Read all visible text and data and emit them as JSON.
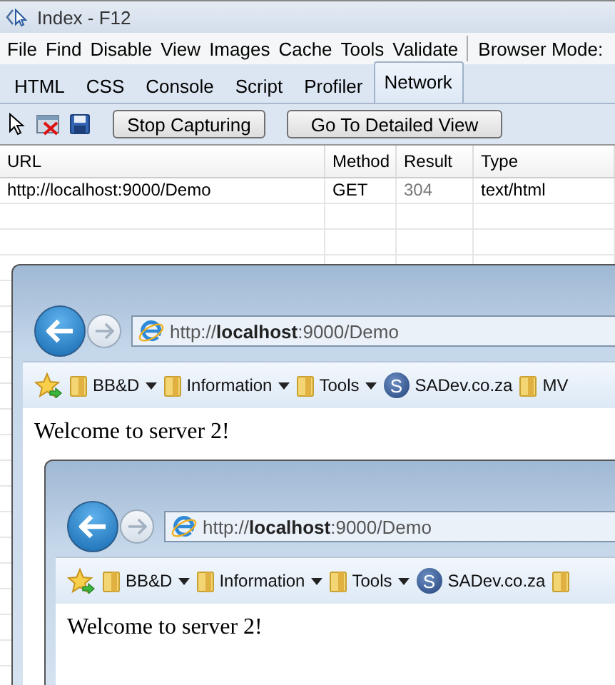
{
  "window": {
    "title": "Index - F12"
  },
  "menu": {
    "items": [
      "File",
      "Find",
      "Disable",
      "View",
      "Images",
      "Cache",
      "Tools",
      "Validate"
    ],
    "browser_mode": "Browser Mode:"
  },
  "tabs": [
    {
      "label": "HTML",
      "selected": false
    },
    {
      "label": "CSS",
      "selected": false
    },
    {
      "label": "Console",
      "selected": false
    },
    {
      "label": "Script",
      "selected": false
    },
    {
      "label": "Profiler",
      "selected": false
    },
    {
      "label": "Network",
      "selected": true
    }
  ],
  "toolbar": {
    "buttons": [
      "Stop Capturing",
      "Go To Detailed View"
    ]
  },
  "table": {
    "columns": [
      "URL",
      "Method",
      "Result",
      "Type"
    ],
    "rows": [
      {
        "url": "http://localhost:9000/Demo",
        "method": "GET",
        "result": "304",
        "type": "text/html"
      }
    ]
  },
  "browser_window": {
    "address": "http://**localhost**:9000/Demo",
    "favorites": [
      {
        "kind": "folder",
        "label": "BB&D",
        "dropdown": true
      },
      {
        "kind": "folder",
        "label": "Information",
        "dropdown": true
      },
      {
        "kind": "folder",
        "label": "Tools",
        "dropdown": true
      },
      {
        "kind": "site",
        "badge": "S",
        "label": "SADev.co.za",
        "dropdown": false
      },
      {
        "kind": "folder",
        "label": "MV",
        "dropdown": false
      }
    ],
    "content": "Welcome to server 2!",
    "nested": {
      "address": "http://**localhost**:9000/Demo",
      "favorites": [
        {
          "kind": "folder",
          "label": "BB&D",
          "dropdown": true
        },
        {
          "kind": "folder",
          "label": "Information",
          "dropdown": true
        },
        {
          "kind": "folder",
          "label": "Tools",
          "dropdown": true
        },
        {
          "kind": "site",
          "badge": "S",
          "label": "SADev.co.za",
          "dropdown": false
        },
        {
          "kind": "folder",
          "dropdown": false
        }
      ],
      "content": "Welcome to server 2!"
    }
  }
}
